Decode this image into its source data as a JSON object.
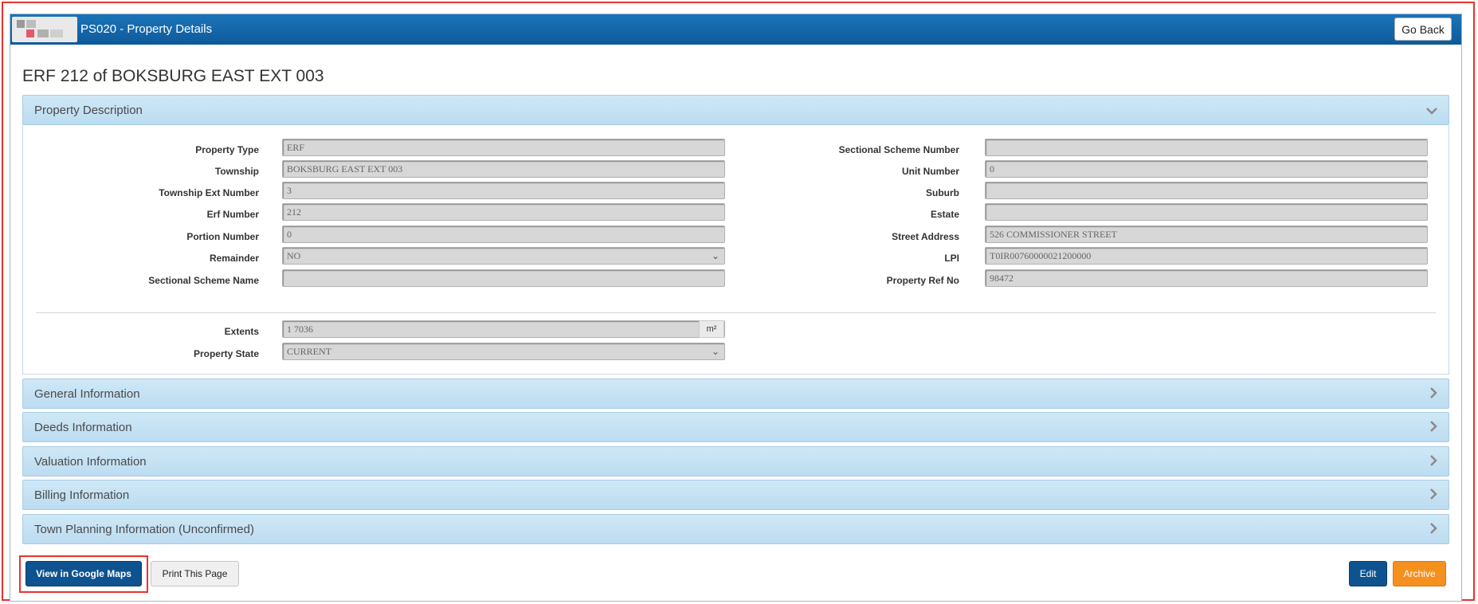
{
  "window": {
    "title": "PS020 - Property Details",
    "go_back": "Go Back"
  },
  "page": {
    "title": "ERF 212 of BOKSBURG EAST EXT 003"
  },
  "property_description": {
    "header": "Property Description",
    "left_fields": [
      {
        "label": "Property Type",
        "value": "ERF"
      },
      {
        "label": "Township",
        "value": "BOKSBURG EAST EXT 003"
      },
      {
        "label": "Township Ext Number",
        "value": "3"
      },
      {
        "label": "Erf Number",
        "value": "212"
      },
      {
        "label": "Portion Number",
        "value": "0"
      },
      {
        "label": "Remainder",
        "value": "NO"
      },
      {
        "label": "Sectional Scheme Name",
        "value": ""
      }
    ],
    "right_fields": [
      {
        "label": "Sectional Scheme Number",
        "value": ""
      },
      {
        "label": "Unit Number",
        "value": "0"
      },
      {
        "label": "Suburb",
        "value": ""
      },
      {
        "label": "Estate",
        "value": ""
      },
      {
        "label": "Street Address",
        "value": "526 COMMISSIONER STREET"
      },
      {
        "label": "LPI",
        "value": "T0IR00760000021200000"
      },
      {
        "label": "Property Ref No",
        "value": "98472"
      }
    ],
    "extents": {
      "label": "Extents",
      "value": "1 7036",
      "unit": "m²"
    },
    "property_state": {
      "label": "Property State",
      "value": "CURRENT"
    }
  },
  "sections": [
    "General Information",
    "Deeds Information",
    "Valuation Information",
    "Billing Information",
    "Town Planning Information (Unconfirmed)"
  ],
  "footer": {
    "google_maps": "View in Google Maps",
    "print": "Print This Page",
    "edit": "Edit",
    "archive": "Archive"
  },
  "colors": {
    "titlebar": "#0e5a9a",
    "accent": "#0e5390",
    "archive": "#f5901e",
    "highlight": "#e8322e"
  }
}
